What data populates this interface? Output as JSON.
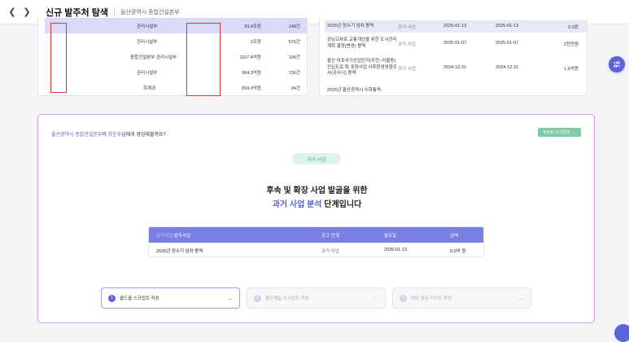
{
  "topbar": {
    "title": "신규 발주처 탐색",
    "breadcrumb": "울산광역시 종합건설본부"
  },
  "left_table": {
    "rows": [
      {
        "dept": "관리시설부",
        "amount": "33.4조원",
        "count": "148건",
        "highlight": true
      },
      {
        "dept": "관리시설부",
        "amount": "2조원",
        "count": "576건",
        "highlight": false
      },
      {
        "dept": "종합건설본부 관리시설부",
        "amount": "1157.4억원",
        "count": "106건",
        "highlight": false
      },
      {
        "dept": "관리시설부",
        "amount": "994.3억원",
        "count": "736건",
        "highlight": false
      },
      {
        "dept": "회계과",
        "amount": "834.9억원",
        "count": "94건",
        "highlight": false
      }
    ]
  },
  "right_table": {
    "rows": [
      {
        "name": "2025년 정수기 임차 용역",
        "stage": "과거 사업",
        "date1": "2025-01-13",
        "date2": "2025-01-13",
        "amount": "0.0원",
        "highlight": true
      },
      {
        "name": "상남교차로 교통개선을 위한 도시관리계획 결정(변경) 용역",
        "stage": "과거 사업",
        "date1": "2025-01-07",
        "date2": "2025-01-07",
        "amount": "2천만원",
        "highlight": false
      },
      {
        "name": "울산 미포국가산업단지(주전~어물동) 진입도로 확·포장사업 사후환경영향조사(공사시) 용역",
        "stage": "과거 사업",
        "date1": "2024-12-31",
        "date2": "2024-12-31",
        "amount": "1.6억원",
        "highlight": false
      },
      {
        "name": "2025년 울산광역시 수화통역..",
        "stage": "",
        "date1": "",
        "date2": "",
        "amount": "",
        "highlight": false
      }
    ]
  },
  "main": {
    "question_org": "울산광역시 종합건설본부",
    "question_mid": "의 ",
    "question_name": "양운수",
    "question_end": "님에게 영업해볼까요?",
    "script_button": "작성된 스크립트",
    "stage_badge": "과거 사업",
    "headline_line1": "후속 및 확장 사업 발굴을 위한",
    "headline_hl": "과거 사업 분석",
    "headline_end": " 단계입니다",
    "table": {
      "headers": {
        "prefix": "과거사업",
        "name": "발주사업",
        "stage": "공고 단계",
        "date": "발주일",
        "amount": "금액"
      },
      "row": {
        "name": "2025년 정수기 임차 용역",
        "stage": "과거 사업",
        "date": "2025-01-13",
        "amount": "0.0억 원"
      }
    },
    "steps": [
      {
        "num": "1",
        "label": "콜드콜 스크립트 작성"
      },
      {
        "num": "2",
        "label": "콜드메일 스크립트 작성"
      },
      {
        "num": "3",
        "label": "예상 질문 리스트 작성"
      }
    ]
  },
  "colors": {
    "accent": "#5c63d8",
    "green": "#7fc9a6",
    "highlight": "#d8daf6",
    "alert": "#e53935"
  }
}
